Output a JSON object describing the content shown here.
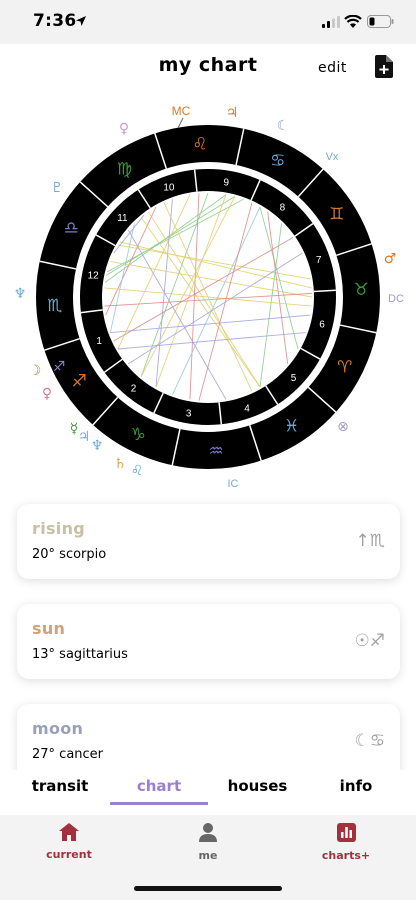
{
  "status_bar": {
    "time": "7:36"
  },
  "header": {
    "title": "my chart",
    "edit_label": "edit"
  },
  "chart_wheel": {
    "angles": {
      "mc": "MC",
      "ic": "IC",
      "vertex": "Vx",
      "descendant": "DC"
    },
    "houses": [
      "1",
      "2",
      "3",
      "4",
      "5",
      "6",
      "7",
      "8",
      "9",
      "10",
      "11",
      "12"
    ],
    "sign_colors": {
      "fire": "#d8782a",
      "earth": "#3a9a3a",
      "air": "#7a7acb",
      "water": "#6aaad4"
    }
  },
  "cards": [
    {
      "title": "rising",
      "value": "20° scorpio",
      "title_color": "#c9c0a4",
      "icon": "↑♏"
    },
    {
      "title": "sun",
      "value": "13° sagittarius",
      "title_color": "#d0a27a",
      "icon": "☉♐"
    },
    {
      "title": "moon",
      "value": "27° cancer",
      "title_color": "#9aa0b8",
      "icon": "☾♋"
    }
  ],
  "tabs": [
    {
      "label": "transit",
      "active": false
    },
    {
      "label": "chart",
      "active": true,
      "color": "#9b7fd1"
    },
    {
      "label": "houses",
      "active": false
    },
    {
      "label": "info",
      "active": false
    }
  ],
  "bottom_nav": [
    {
      "label": "current",
      "icon": "home-icon",
      "active": true,
      "color": "#a3303c"
    },
    {
      "label": "me",
      "icon": "person-icon",
      "active": false,
      "color": "#666666"
    },
    {
      "label": "charts+",
      "icon": "bar-chart-icon",
      "active": false,
      "color": "#a3303c"
    }
  ]
}
